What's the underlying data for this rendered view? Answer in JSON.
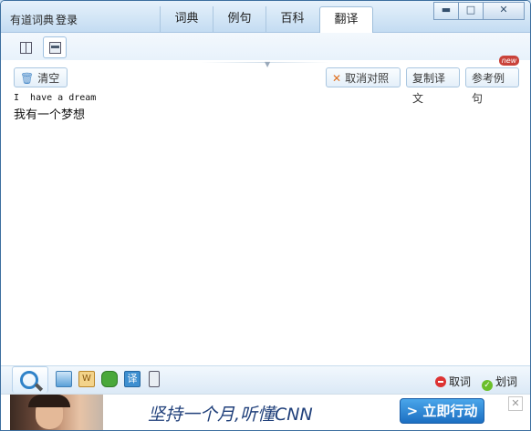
{
  "window": {
    "app_name": "有道词典",
    "login_label": "登录",
    "controls": {
      "minimize": "▬",
      "maximize": "□",
      "close": "✕"
    }
  },
  "tabs": [
    {
      "label": "词典",
      "active": false
    },
    {
      "label": "例句",
      "active": false
    },
    {
      "label": "百科",
      "active": false
    },
    {
      "label": "翻译",
      "active": true
    }
  ],
  "toolbar": {
    "clear_label": "清空",
    "cancel_align_label": "取消对照",
    "copy_translation_label": "复制译文",
    "reference_examples_label": "参考例句",
    "new_badge": "new"
  },
  "translation": {
    "source_text": "I  have a dream",
    "target_text": "我有一个梦想"
  },
  "bottom": {
    "lookup_word_label": "取词",
    "select_word_label": "划词",
    "colors": {
      "red": "#dd3333",
      "green": "#6bbf2a"
    }
  },
  "ad": {
    "headline": "坚持一个月,听懂CNN",
    "cta_label": "> 立即行动",
    "close_label": "✕"
  }
}
